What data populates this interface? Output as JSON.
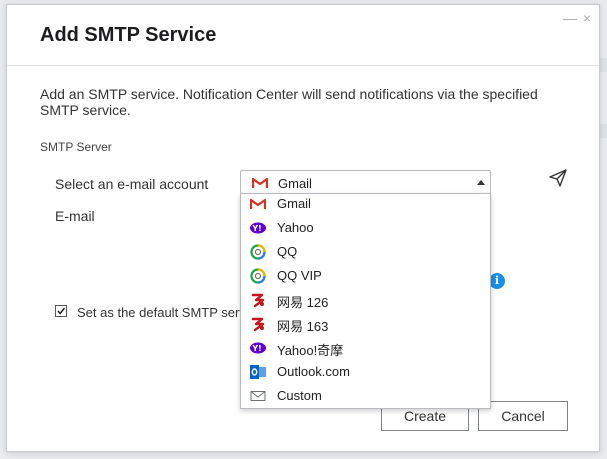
{
  "dialog": {
    "title": "Add SMTP Service",
    "minimize_glyph": "—",
    "close_glyph": "×",
    "description": "Add an SMTP service. Notification Center will send notifications via the specified SMTP service.",
    "section_label": "SMTP Server"
  },
  "form": {
    "account_label": "Select an e-mail account",
    "email_label": "E-mail",
    "selected_account": "Gmail",
    "selected_icon": "gmail-icon",
    "send_test_icon": "paper-plane-icon",
    "info_icon": "info-icon",
    "info_glyph": "i",
    "default_checkbox_checked": true,
    "default_checkbox_label": "Set as the default SMTP server"
  },
  "dropdown": {
    "options": [
      {
        "label": "Gmail",
        "icon": "gmail-icon"
      },
      {
        "label": "Yahoo",
        "icon": "yahoo-icon"
      },
      {
        "label": "QQ",
        "icon": "qq-icon"
      },
      {
        "label": "QQ VIP",
        "icon": "qq-vip-icon"
      },
      {
        "label": "网易 126",
        "icon": "netease-icon"
      },
      {
        "label": "网易 163",
        "icon": "netease-icon"
      },
      {
        "label": "Yahoo!奇摩",
        "icon": "yahoo-icon"
      },
      {
        "label": "Outlook.com",
        "icon": "outlook-icon"
      },
      {
        "label": "Custom",
        "icon": "envelope-icon"
      }
    ]
  },
  "buttons": {
    "create": "Create",
    "cancel": "Cancel"
  },
  "colors": {
    "accent": "#1b8ee6",
    "gmail_red": "#d93025",
    "yahoo_purple": "#5f01d1",
    "netease_red": "#c4161c",
    "outlook_blue": "#0a64c8"
  }
}
